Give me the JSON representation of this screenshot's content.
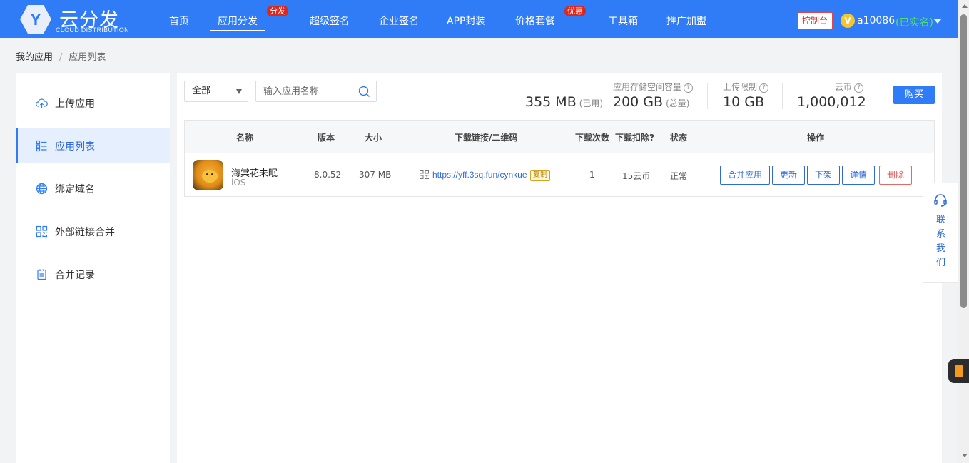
{
  "brand": {
    "title": "云分发",
    "subtitle": "CLOUD DISTRIBUTION",
    "letter": "Y"
  },
  "nav": {
    "items": [
      {
        "label": "首页"
      },
      {
        "label": "应用分发",
        "badge": "分发",
        "active": true
      },
      {
        "label": "超级签名"
      },
      {
        "label": "企业签名"
      },
      {
        "label": "APP封装"
      },
      {
        "label": "价格套餐",
        "badge": "优惠"
      },
      {
        "label": "工具箱"
      },
      {
        "label": "推广加盟"
      }
    ],
    "console_label": "控制台",
    "vip_letter": "V",
    "user_name": "a10086",
    "user_status": "(已实名)"
  },
  "breadcrumb": {
    "root": "我的应用",
    "separator": "/",
    "current": "应用列表"
  },
  "sidebar": {
    "items": [
      {
        "label": "上传应用",
        "icon": "cloud-upload-icon"
      },
      {
        "label": "应用列表",
        "icon": "list-icon",
        "active": true
      },
      {
        "label": "绑定域名",
        "icon": "globe-icon"
      },
      {
        "label": "外部链接合并",
        "icon": "qrcode-icon"
      },
      {
        "label": "合并记录",
        "icon": "clipboard-icon"
      }
    ]
  },
  "toolbar": {
    "filter_value": "全部",
    "search_placeholder": "输入应用名称"
  },
  "stats": {
    "used": {
      "value": "355 MB",
      "unit": "(已用)"
    },
    "storage": {
      "label": "应用存储空间容量",
      "value": "200 GB",
      "unit": "(总量)"
    },
    "upload_limit": {
      "label": "上传限制",
      "value": "10 GB"
    },
    "coins": {
      "label": "云币",
      "value": "1,000,012"
    },
    "help_glyph": "?",
    "buy_label": "购买"
  },
  "table": {
    "headers": {
      "name": "名称",
      "version": "版本",
      "size": "大小",
      "link": "下载链接/二维码",
      "downloads": "下载次数",
      "deduction": "下载扣除?",
      "status": "状态",
      "actions": "操作"
    },
    "rows": [
      {
        "name": "海棠花未眠",
        "platform": "iOS",
        "version": "8.0.52",
        "size": "307 MB",
        "link": "https://yff.3sq.fun/cynkue",
        "copy_label": "复制",
        "downloads": "1",
        "deduction": "15云币",
        "status": "正常",
        "actions": {
          "merge": "合并应用",
          "update": "更新",
          "offline": "下架",
          "detail": "详情",
          "delete": "删除"
        }
      }
    ]
  },
  "contact": {
    "label": "联系我们",
    "chars": [
      "联",
      "系",
      "我",
      "们"
    ]
  },
  "colors": {
    "primary": "#2f7cf6",
    "danger": "#e04b4b",
    "verified": "#4ee06c"
  }
}
